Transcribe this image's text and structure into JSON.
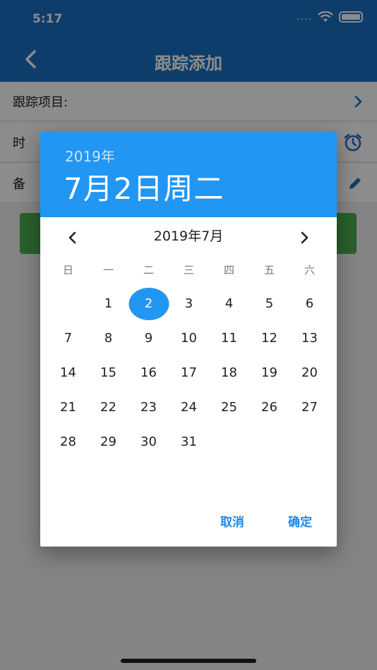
{
  "status_bar": {
    "time": "5:17",
    "cell": "....",
    "wifi_icon": "wifi-icon",
    "battery_icon": "battery-icon"
  },
  "app_bar": {
    "title": "跟踪添加",
    "back_icon": "chevron-left-icon"
  },
  "form": {
    "rows": [
      {
        "label": "跟踪项目:",
        "icon": "chevron-right-icon"
      },
      {
        "label": "时",
        "icon": "alarm-icon"
      },
      {
        "label": "备",
        "icon": "pencil-icon"
      }
    ]
  },
  "colors": {
    "primary": "#1c6fc4",
    "accent": "#2196f3",
    "submit": "#4caf50"
  },
  "date_picker": {
    "year": "2019年",
    "selected_date": "7月2日周二",
    "month_label": "2019年7月",
    "weekdays": [
      "日",
      "一",
      "二",
      "三",
      "四",
      "五",
      "六"
    ],
    "first_weekday_offset": 1,
    "days": [
      "1",
      "2",
      "3",
      "4",
      "5",
      "6",
      "7",
      "8",
      "9",
      "10",
      "11",
      "12",
      "13",
      "14",
      "15",
      "16",
      "17",
      "18",
      "19",
      "20",
      "21",
      "22",
      "23",
      "24",
      "25",
      "26",
      "27",
      "28",
      "29",
      "30",
      "31"
    ],
    "selected_day": "2",
    "cancel_label": "取消",
    "ok_label": "确定"
  }
}
